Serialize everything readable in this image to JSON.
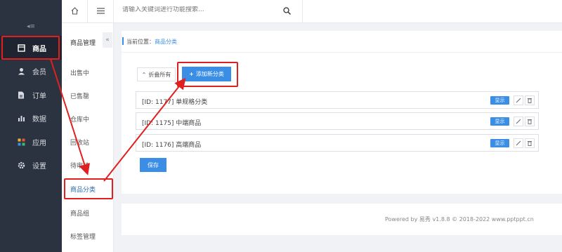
{
  "sidebar": {
    "collapse_glyph": "◂≡",
    "items": [
      {
        "label": "商品",
        "icon": "goods-icon",
        "active": true
      },
      {
        "label": "会员",
        "icon": "user-icon"
      },
      {
        "label": "订单",
        "icon": "order-icon"
      },
      {
        "label": "数据",
        "icon": "chart-icon"
      },
      {
        "label": "应用",
        "icon": "apps-icon"
      },
      {
        "label": "设置",
        "icon": "gear-icon"
      }
    ]
  },
  "topbar": {
    "search_placeholder": "请输入关键词进行功能搜索...",
    "home_icon": "home-icon",
    "menu_icon": "menu-icon",
    "search_icon": "search-icon"
  },
  "subnav": {
    "title": "商品管理",
    "collapse_glyph": "«",
    "items": [
      "出售中",
      "已售罄",
      "仓库中",
      "回收站",
      "待审核",
      "商品分类",
      "商品组",
      "标签管理"
    ],
    "active": "商品分类"
  },
  "breadcrumb": {
    "prefix": "当前位置：",
    "current": "商品分类"
  },
  "actions": {
    "fold_label": "折叠所有",
    "add_label": "添加新分类",
    "save_label": "保存"
  },
  "categories": [
    {
      "label": "[ID: 1177] 单规格分类",
      "badge": "显示"
    },
    {
      "label": "[ID: 1175] 中端商品",
      "badge": "显示"
    },
    {
      "label": "[ID: 1176] 高端商品",
      "badge": "显示"
    }
  ],
  "footer": {
    "text": "Powered by 易秀 v1.8.8 © 2018-2022 www.pptppt.cn"
  },
  "colors": {
    "accent": "#3a8ee6",
    "sidebar_bg": "#2b3340",
    "annotation": "#e02020"
  }
}
